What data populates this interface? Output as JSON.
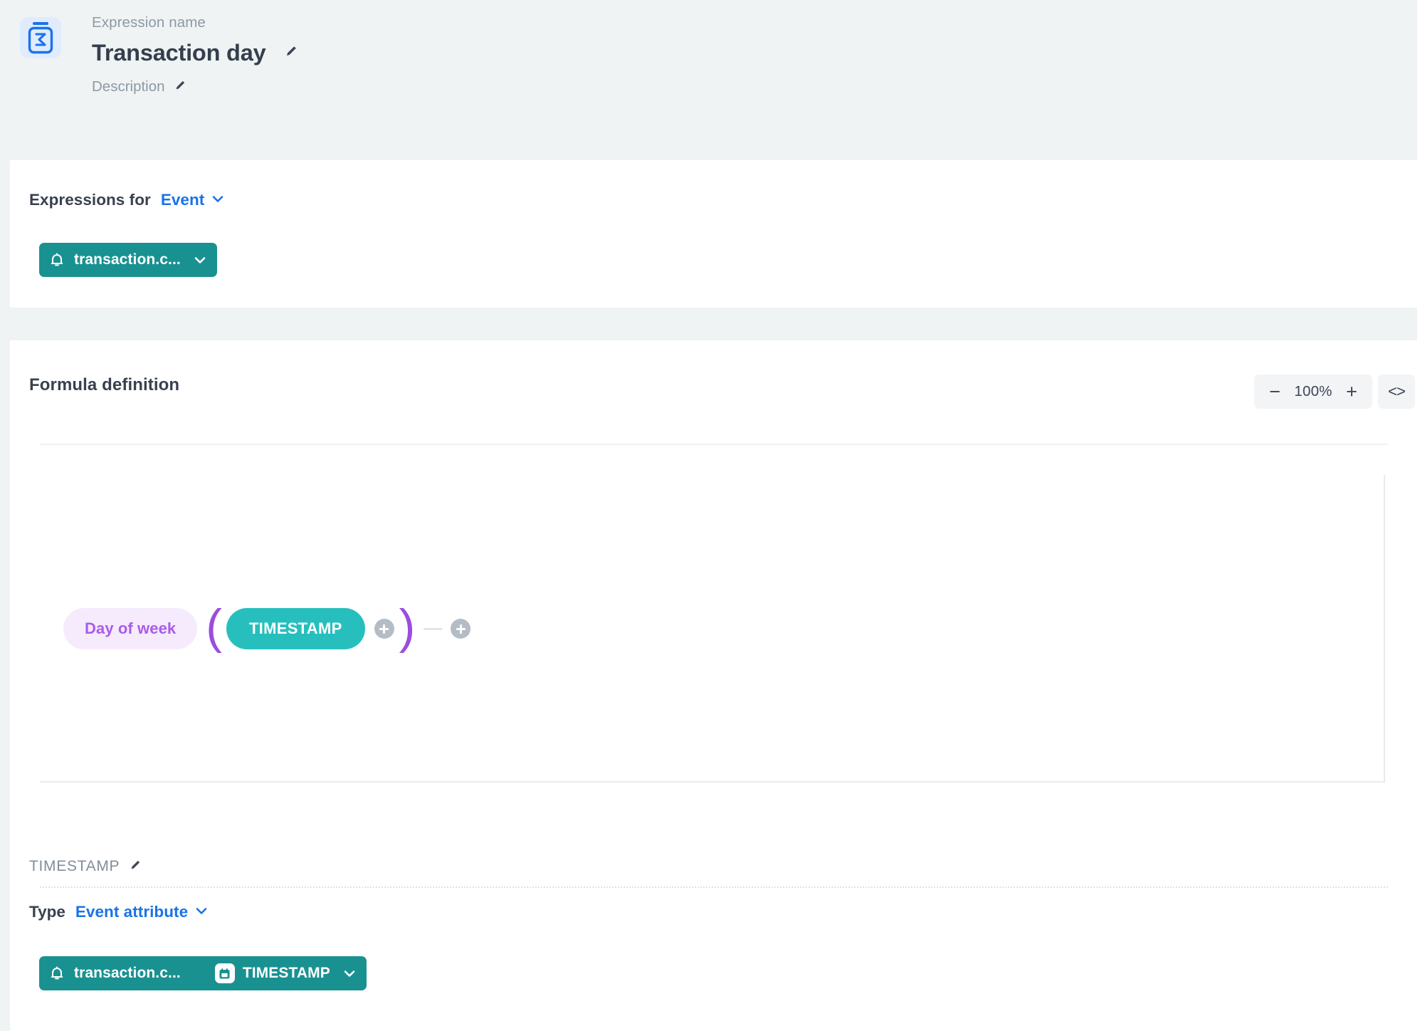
{
  "header": {
    "icon": "sigma-expression-icon",
    "expression_name_label": "Expression name",
    "title": "Transaction day",
    "description_label": "Description",
    "edit_icon": "pencil-icon"
  },
  "expressions_card": {
    "label": "Expressions for",
    "entity_select": {
      "value": "Event",
      "chevron_icon": "chevron-down-icon"
    },
    "event_chip": {
      "icon": "bell-icon",
      "text": "transaction.c...",
      "chevron_icon": "chevron-down-icon"
    }
  },
  "formula_card": {
    "title": "Formula definition",
    "zoom": {
      "decrease_label": "−",
      "value": "100%",
      "increase_label": "+",
      "code_label": "<>"
    },
    "expression": {
      "function_pill": "Day of week",
      "paren_open": "(",
      "argument_pill": "TIMESTAMP",
      "paren_close": ")",
      "add_argument_icon": "plus-circle-icon",
      "add_operand_icon": "plus-circle-icon",
      "operator_placeholder_icon": "dash-icon"
    }
  },
  "detail_panel": {
    "title": "TIMESTAMP",
    "edit_icon": "pencil-icon",
    "type_label": "Type",
    "type_value": "Event attribute",
    "type_chevron_icon": "chevron-down-icon",
    "attribute_chip": {
      "event_icon": "bell-icon",
      "event_text": "transaction.c...",
      "attribute_icon": "calendar-icon",
      "attribute_text": "TIMESTAMP",
      "chevron_icon": "chevron-down-icon"
    }
  },
  "colors": {
    "page_background": "#eff3f4",
    "card_background": "#ffffff",
    "accent_blue": "#1a73e8",
    "chip_teal": "#1a9191",
    "pill_teal": "#26bfbe",
    "pill_purple_bg": "#f6ebfc",
    "pill_purple_text": "#a95cea",
    "paren_purple": "#9b4ddd",
    "muted_text": "#8d99a4",
    "heading_text": "#39414f"
  }
}
